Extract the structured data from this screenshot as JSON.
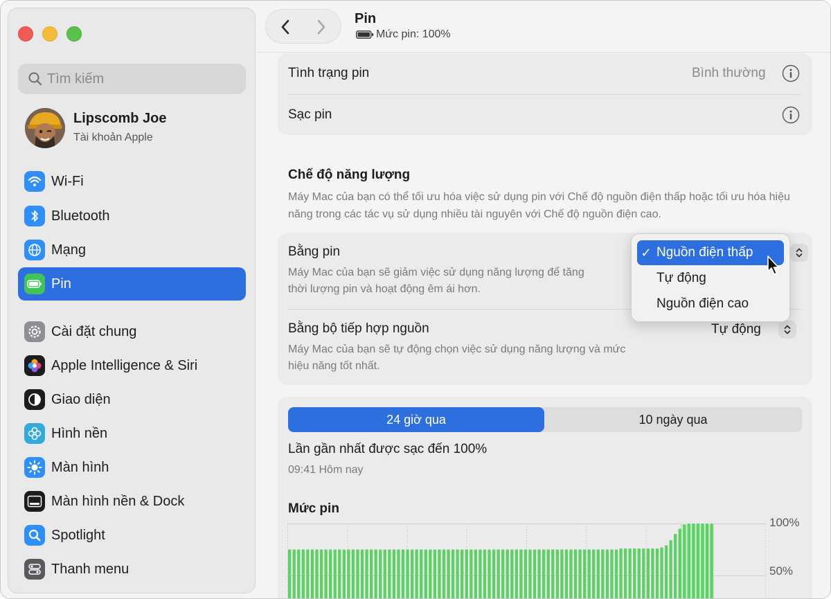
{
  "sidebar": {
    "search_placeholder": "Tìm kiếm",
    "account": {
      "name": "Lipscomb Joe",
      "subtitle": "Tài khoản Apple"
    },
    "items": [
      {
        "label": "Wi-Fi",
        "icon": "wifi-icon",
        "color": "#2f8ff6"
      },
      {
        "label": "Bluetooth",
        "icon": "bluetooth-icon",
        "color": "#2f8ff6"
      },
      {
        "label": "Mạng",
        "icon": "globe-icon",
        "color": "#2f8ff6"
      },
      {
        "label": "Pin",
        "icon": "battery-icon",
        "color": "#42c359",
        "active": true
      },
      {
        "label": "Cài đặt chung",
        "icon": "gear-icon",
        "color": "#8e8e93"
      },
      {
        "label": "Apple Intelligence & Siri",
        "icon": "siri-icon",
        "color": "#d8d8dc"
      },
      {
        "label": "Giao diện",
        "icon": "appearance-icon",
        "color": "#1c1c1e"
      },
      {
        "label": "Hình nền",
        "icon": "wallpaper-icon",
        "color": "#34aadc"
      },
      {
        "label": "Màn hình",
        "icon": "display-icon",
        "color": "#2f8ff6"
      },
      {
        "label": "Màn hình nền & Dock",
        "icon": "dock-icon",
        "color": "#1c1c1e"
      },
      {
        "label": "Spotlight",
        "icon": "spotlight-icon",
        "color": "#2f8ff6"
      },
      {
        "label": "Thanh menu",
        "icon": "menubar-icon",
        "color": "#5a5a5e"
      }
    ]
  },
  "header": {
    "title": "Pin",
    "subtitle": "Mức pin: 100%"
  },
  "battery_info": {
    "health_label": "Tình trạng pin",
    "health_value": "Bình thường",
    "charging_label": "Sạc pin"
  },
  "energy_mode": {
    "title": "Chế độ năng lượng",
    "description": "Máy Mac của bạn có thể tối ưu hóa việc sử dụng pin với Chế độ nguồn điện thấp hoặc tối ưu hóa hiệu năng trong các tác vụ sử dụng nhiều tài nguyên với Chế độ nguồn điện cao.",
    "on_battery": {
      "label": "Bằng pin",
      "description_line1": "Máy Mac của bạn sẽ giảm việc sử dụng năng lượng để tăng",
      "description_line2": "thời lượng pin và hoạt động êm ái hơn."
    },
    "on_adapter": {
      "label": "Bằng bộ tiếp hợp nguồn",
      "value": "Tự động",
      "description_line1": "Máy Mac của bạn sẽ tự động chọn việc sử dụng năng lượng và mức",
      "description_line2": "hiệu năng tốt nhất."
    },
    "popup_options": [
      {
        "label": "Nguồn điện thấp",
        "selected": true
      },
      {
        "label": "Tự động",
        "selected": false
      },
      {
        "label": "Nguồn điện cao",
        "selected": false
      }
    ]
  },
  "usage": {
    "tabs": [
      "24 giờ qua",
      "10 ngày qua"
    ],
    "active_tab": 0,
    "last_charged_label": "Lần gần nhất được sạc đến 100%",
    "last_charged_time": "09:41 Hôm nay",
    "chart_title": "Mức pin"
  },
  "chart_data": {
    "type": "bar",
    "title": "Mức pin",
    "y_ticks": [
      "100%",
      "50%"
    ],
    "ylim": [
      0,
      100
    ],
    "values": [
      75,
      75,
      75,
      75,
      75,
      75,
      75,
      75,
      75,
      75,
      75,
      75,
      75,
      75,
      75,
      75,
      75,
      75,
      75,
      75,
      75,
      75,
      75,
      75,
      75,
      75,
      75,
      75,
      75,
      75,
      75,
      75,
      75,
      75,
      75,
      75,
      75,
      75,
      75,
      75,
      75,
      75,
      75,
      75,
      75,
      75,
      75,
      75,
      75,
      75,
      75,
      75,
      75,
      75,
      75,
      75,
      75,
      75,
      75,
      75,
      75,
      75,
      75,
      75,
      75,
      75,
      75,
      75,
      75,
      75,
      75,
      75,
      75,
      76,
      76,
      76,
      76,
      76,
      76,
      76,
      76,
      76,
      77,
      79,
      84,
      90,
      95,
      99,
      100,
      100,
      100,
      100,
      100,
      100
    ],
    "charging_start_index": 87,
    "colors": {
      "bar": "#5fd068",
      "charging_bg": "#c9ecc9",
      "grid": "#d0d0d0"
    }
  }
}
